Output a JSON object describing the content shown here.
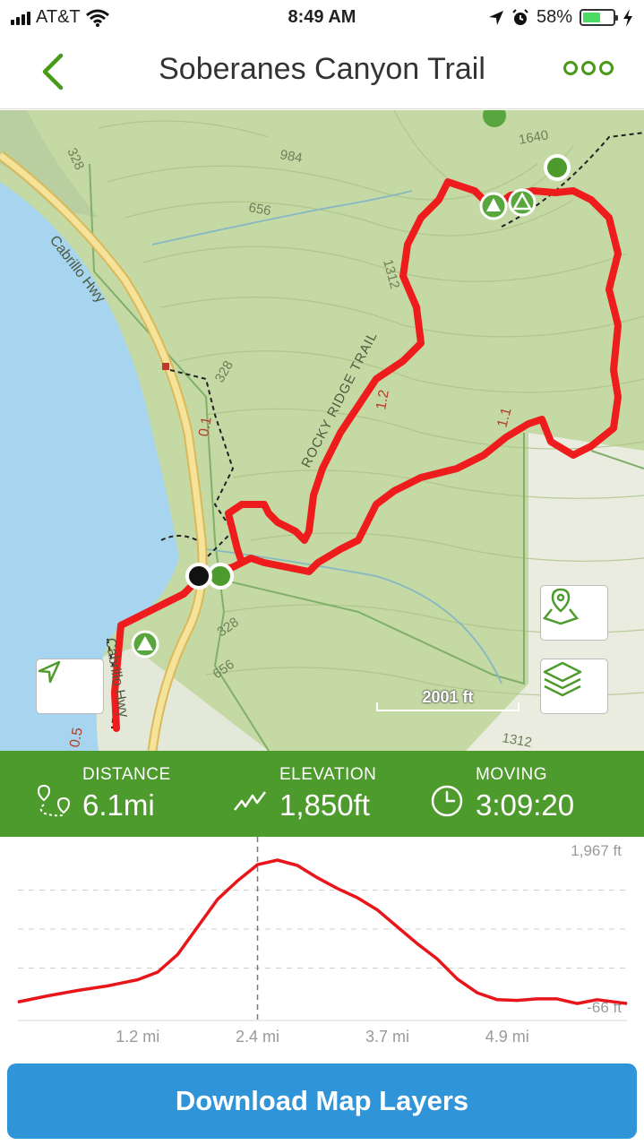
{
  "status_bar": {
    "carrier": "AT&T",
    "time": "8:49 AM",
    "battery_percent": "58%",
    "battery_level": 0.58,
    "icons": [
      "signal-icon",
      "wifi-icon",
      "location-arrow-icon",
      "alarm-icon",
      "battery-icon",
      "charging-bolt-icon"
    ]
  },
  "nav": {
    "title": "Soberanes Canyon Trail",
    "back_icon": "chevron-left-icon",
    "more_icon": "more-options-icon"
  },
  "map": {
    "road_labels": [
      "Cabrillo Hwy",
      "Cabrillo Hwy"
    ],
    "trail_labels": [
      "ROCKY RIDGE TRAIL"
    ],
    "contour_labels": [
      "328",
      "984",
      "656",
      "1640",
      "1312",
      "328",
      "656",
      "328",
      "1312",
      "328"
    ],
    "mile_markers": [
      "0.1",
      "1.2",
      "1.1",
      "0.5"
    ],
    "scale_label": "2001 ft",
    "buttons": {
      "locate": "location-arrow-icon",
      "waypoint": "map-pin-icon",
      "layers": "layers-icon"
    },
    "colors": {
      "route": "#ee1c1c",
      "terrain": "#c9dba8",
      "water": "#a7d4ef",
      "road": "#f2d88a"
    }
  },
  "stats": {
    "distance": {
      "label": "DISTANCE",
      "value": "6.1mi",
      "icon": "distance-pins-icon"
    },
    "elevation": {
      "label": "ELEVATION",
      "value": "1,850ft",
      "icon": "elevation-zigzag-icon"
    },
    "moving": {
      "label": "MOVING",
      "value": "3:09:20",
      "icon": "clock-icon"
    },
    "color": "#4e9b2d"
  },
  "chart_data": {
    "type": "line",
    "title": "",
    "xlabel": "",
    "ylabel": "",
    "y_top_label": "1,967 ft",
    "y_bottom_label": "-66 ft",
    "x_tick_labels": [
      "1.2 mi",
      "2.4 mi",
      "3.7 mi",
      "4.9 mi"
    ],
    "x_ticks": [
      1.2,
      2.4,
      3.7,
      4.9
    ],
    "xlim": [
      0,
      6.1
    ],
    "ylim": [
      -66,
      1967
    ],
    "grid": true,
    "cursor_x": 2.4,
    "series": [
      {
        "color": "#e8151b",
        "x": [
          0,
          0.3,
          0.6,
          0.9,
          1.2,
          1.4,
          1.6,
          1.8,
          2.0,
          2.2,
          2.4,
          2.6,
          2.8,
          3.0,
          3.2,
          3.4,
          3.6,
          3.8,
          4.0,
          4.2,
          4.4,
          4.6,
          4.8,
          5.0,
          5.2,
          5.4,
          5.6,
          5.8,
          6.1
        ],
        "y": [
          0,
          80,
          150,
          210,
          290,
          390,
          620,
          980,
          1340,
          1580,
          1790,
          1850,
          1780,
          1620,
          1480,
          1360,
          1200,
          980,
          760,
          560,
          300,
          120,
          30,
          20,
          40,
          40,
          -20,
          30,
          -20
        ]
      }
    ]
  },
  "download_button": {
    "label": "Download Map Layers"
  }
}
